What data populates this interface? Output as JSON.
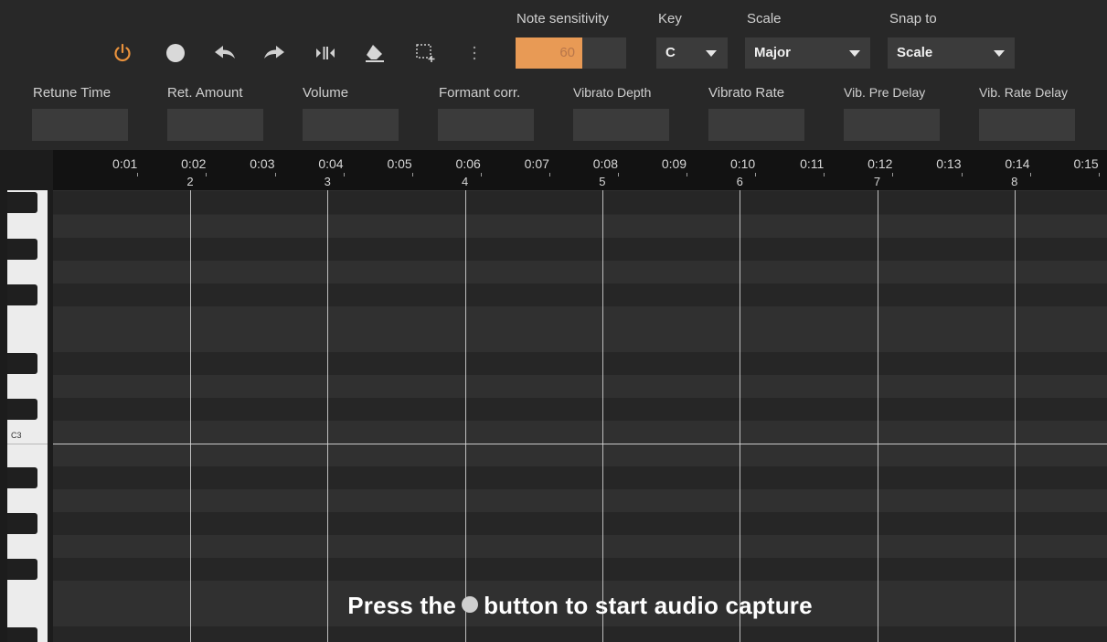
{
  "toolbar": {
    "icons": [
      "power-icon",
      "record-icon",
      "undo-icon",
      "redo-icon",
      "split-icon",
      "eraser-icon",
      "select-icon",
      "more-icon"
    ],
    "note_sensitivity": {
      "label": "Note sensitivity",
      "value": "60",
      "level": 0.6
    },
    "key": {
      "label": "Key",
      "value": "C"
    },
    "scale": {
      "label": "Scale",
      "value": "Major"
    },
    "snap_to": {
      "label": "Snap to",
      "value": "Scale"
    }
  },
  "params": [
    {
      "label": "Retune Time"
    },
    {
      "label": "Ret. Amount"
    },
    {
      "label": "Volume"
    },
    {
      "label": "Formant corr."
    },
    {
      "label": "Vibrato Depth"
    },
    {
      "label": "Vibrato Rate"
    },
    {
      "label": "Vib. Pre Delay"
    },
    {
      "label": "Vib. Rate Delay"
    }
  ],
  "ruler": {
    "times": [
      "0:01",
      "0:02",
      "0:03",
      "0:04",
      "0:05",
      "0:06",
      "0:07",
      "0:08",
      "0:09",
      "0:10",
      "0:11",
      "0:12",
      "0:13",
      "0:14",
      "0:15"
    ],
    "bars": [
      "2",
      "3",
      "4",
      "5",
      "6",
      "7",
      "8"
    ]
  },
  "keyboard": {
    "octave_label": "C3"
  },
  "capture_message": {
    "before": "Press the",
    "after": "button to start audio capture"
  },
  "colors": {
    "accent": "#e89a55",
    "power": "#e8913c",
    "background": "#1c1c1c",
    "panel": "#282828",
    "field": "#3b3b3b"
  }
}
